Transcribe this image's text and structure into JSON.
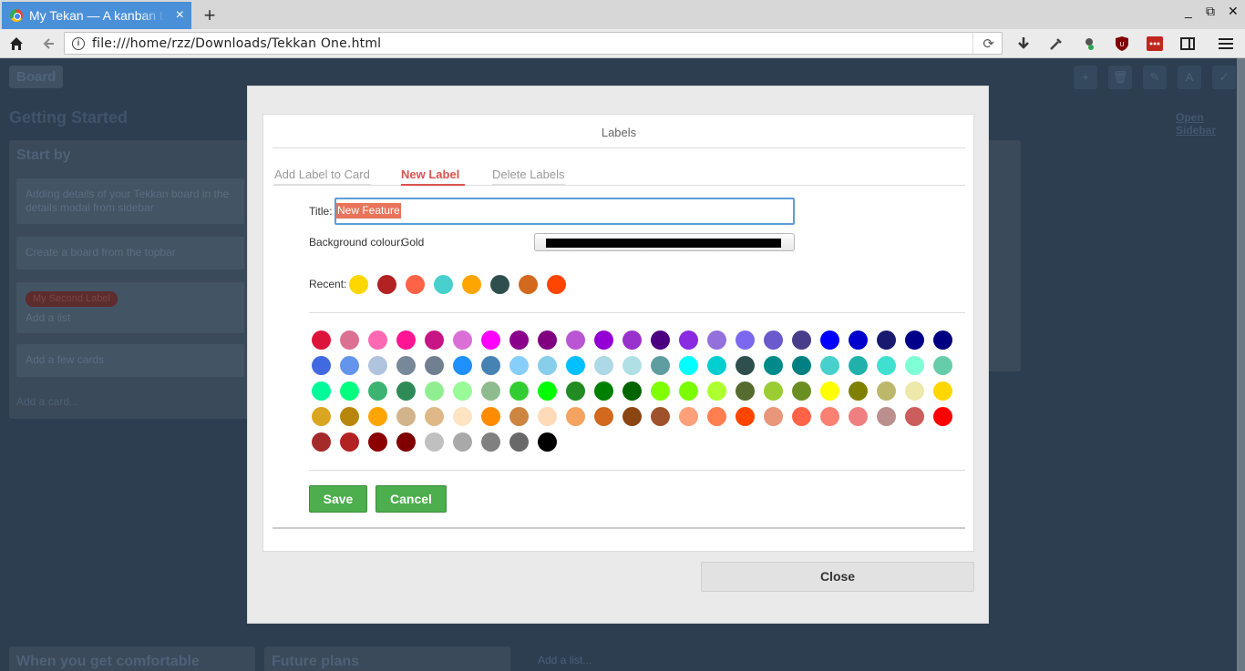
{
  "browser": {
    "tab_title": "My Tekan — A kanban t",
    "url": "file:///home/rzz/Downloads/Tekkan One.html",
    "tab_close": "×",
    "new_tab": "+",
    "window_controls": [
      "minimize-icon",
      "restore-icon",
      "close-icon"
    ],
    "window_control_glyphs": [
      "_",
      "⧉",
      "✕"
    ],
    "toolbar_icons": [
      "download-icon",
      "eyedropper-icon",
      "extension-icon",
      "ublock-icon",
      "lastpass-icon",
      "sidebar-icon",
      "menu-icon"
    ]
  },
  "page": {
    "board_button": "Board",
    "board_title": "Getting Started",
    "open_sidebar": "Open Sidebar",
    "top_icons": [
      "+",
      "🗑",
      "✎",
      "A",
      "✓"
    ],
    "list1": {
      "title": "Start by",
      "cards": [
        {
          "label": "",
          "text": "Adding details of your Tekkan board in the details modal from sidebar"
        },
        {
          "label": "",
          "text": "Create a board from the topbar"
        },
        {
          "label": "My Second Label",
          "text": "Add a list"
        },
        {
          "label": "",
          "text": "Add a few cards"
        }
      ],
      "add_card": "Add a card..."
    },
    "list2_title": "When you get comfortable",
    "list3_title": "Future plans",
    "add_list": "Add a list..."
  },
  "modal": {
    "header": "Labels",
    "tabs": [
      {
        "label": "Add Label to Card",
        "active": false
      },
      {
        "label": "New Label",
        "active": true
      },
      {
        "label": "Delete Labels",
        "active": false
      }
    ],
    "title_label": "Title:",
    "title_value": "New Feature",
    "bg_label": "Background colour:",
    "bg_value": "Gold",
    "bg_swatch_color": "#000000",
    "recent_label": "Recent:",
    "recent_colors": [
      "#ffd700",
      "#b22222",
      "#ff6347",
      "#48d1cc",
      "#ffa500",
      "#2f4f4f",
      "#d2691e",
      "#ff4500"
    ],
    "palette": [
      [
        "#dc143c",
        "#db7093",
        "#ff69b4",
        "#ff1493",
        "#c71585",
        "#da70d6",
        "#ff00ff",
        "#8b008b",
        "#800080",
        "#ba55d3",
        "#9400d3",
        "#9932cc",
        "#4b0082",
        "#8a2be2",
        "#9370db",
        "#7b68ee",
        "#6a5acd",
        "#483d8b",
        "#0000ff",
        "#0000cd",
        "#191970",
        "#00008b",
        "#000080"
      ],
      [
        "#4169e1",
        "#6495ed",
        "#b0c4de",
        "#778899",
        "#708090",
        "#1e90ff",
        "#4682b4",
        "#87cefa",
        "#87ceeb",
        "#00bfff",
        "#add8e6",
        "#b0e0e6",
        "#5f9ea0",
        "#00ffff",
        "#00ced1",
        "#2f4f4f",
        "#008b8b",
        "#008080",
        "#48d1cc",
        "#20b2aa",
        "#40e0d0",
        "#7fffd4",
        "#66cdaa"
      ],
      [
        "#00fa9a",
        "#00ff7f",
        "#3cb371",
        "#2e8b57",
        "#90ee90",
        "#98fb98",
        "#8fbc8f",
        "#32cd32",
        "#00ff00",
        "#228b22",
        "#008000",
        "#006400",
        "#7fff00",
        "#7cfc00",
        "#adff2f",
        "#556b2f",
        "#9acd32",
        "#6b8e23",
        "#ffff00",
        "#808000",
        "#bdb76b",
        "#eee8aa",
        "#ffd700"
      ],
      [
        "#daa520",
        "#b8860b",
        "#ffa500",
        "#d2b48c",
        "#deb887",
        "#ffe4c4",
        "#ff8c00",
        "#cd853f",
        "#ffdab9",
        "#f4a460",
        "#d2691e",
        "#8b4513",
        "#a0522d",
        "#ffa07a",
        "#ff7f50",
        "#ff4500",
        "#e9967a",
        "#ff6347",
        "#fa8072",
        "#f08080",
        "#bc8f8f",
        "#cd5c5c",
        "#ff0000"
      ],
      [
        "#a52a2a",
        "#b22222",
        "#8b0000",
        "#800000",
        "#c0c0c0",
        "#a9a9a9",
        "#808080",
        "#696969",
        "#000000"
      ]
    ],
    "save": "Save",
    "cancel": "Cancel",
    "close": "Close"
  }
}
